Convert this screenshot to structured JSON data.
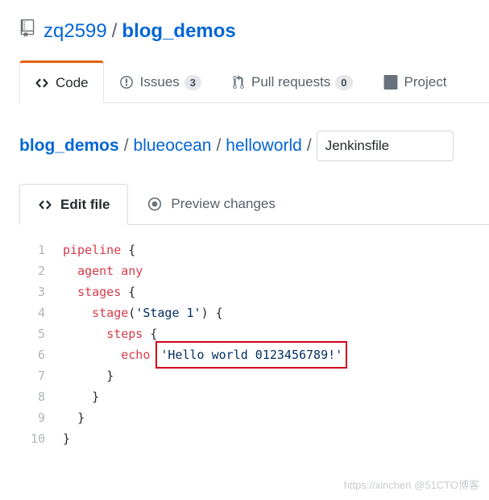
{
  "repo": {
    "owner": "zq2599",
    "name": "blog_demos"
  },
  "nav": {
    "code": "Code",
    "issues": {
      "label": "Issues",
      "count": "3"
    },
    "pulls": {
      "label": "Pull requests",
      "count": "0"
    },
    "projects": "Project"
  },
  "breadcrumb": {
    "root": "blog_demos",
    "p1": "blueocean",
    "p2": "helloworld",
    "filename": "Jenkinsfile"
  },
  "editorTabs": {
    "edit": "Edit file",
    "preview": "Preview changes"
  },
  "code": {
    "l1": {
      "no": "1",
      "a": "pipeline",
      "b": " {"
    },
    "l2": {
      "no": "2",
      "a": "agent",
      "b": " ",
      "c": "any"
    },
    "l3": {
      "no": "3",
      "a": "stages",
      "b": " {"
    },
    "l4": {
      "no": "4",
      "a": "stage",
      "b": "(",
      "c": "'Stage 1'",
      "d": ") {"
    },
    "l5": {
      "no": "5",
      "a": "steps",
      "b": " {"
    },
    "l6": {
      "no": "6",
      "a": "echo",
      "b": " ",
      "c": "'Hello world 0123456789!'"
    },
    "l7": {
      "no": "7",
      "a": "}"
    },
    "l8": {
      "no": "8",
      "a": "}"
    },
    "l9": {
      "no": "9",
      "a": "}"
    },
    "l10": {
      "no": "10",
      "a": "}"
    }
  },
  "indent": {
    "i0": "",
    "i1": "  ",
    "i2": "    ",
    "i3": "      ",
    "i4": "        "
  },
  "watermark": "https://xinchen @51CTO博客"
}
